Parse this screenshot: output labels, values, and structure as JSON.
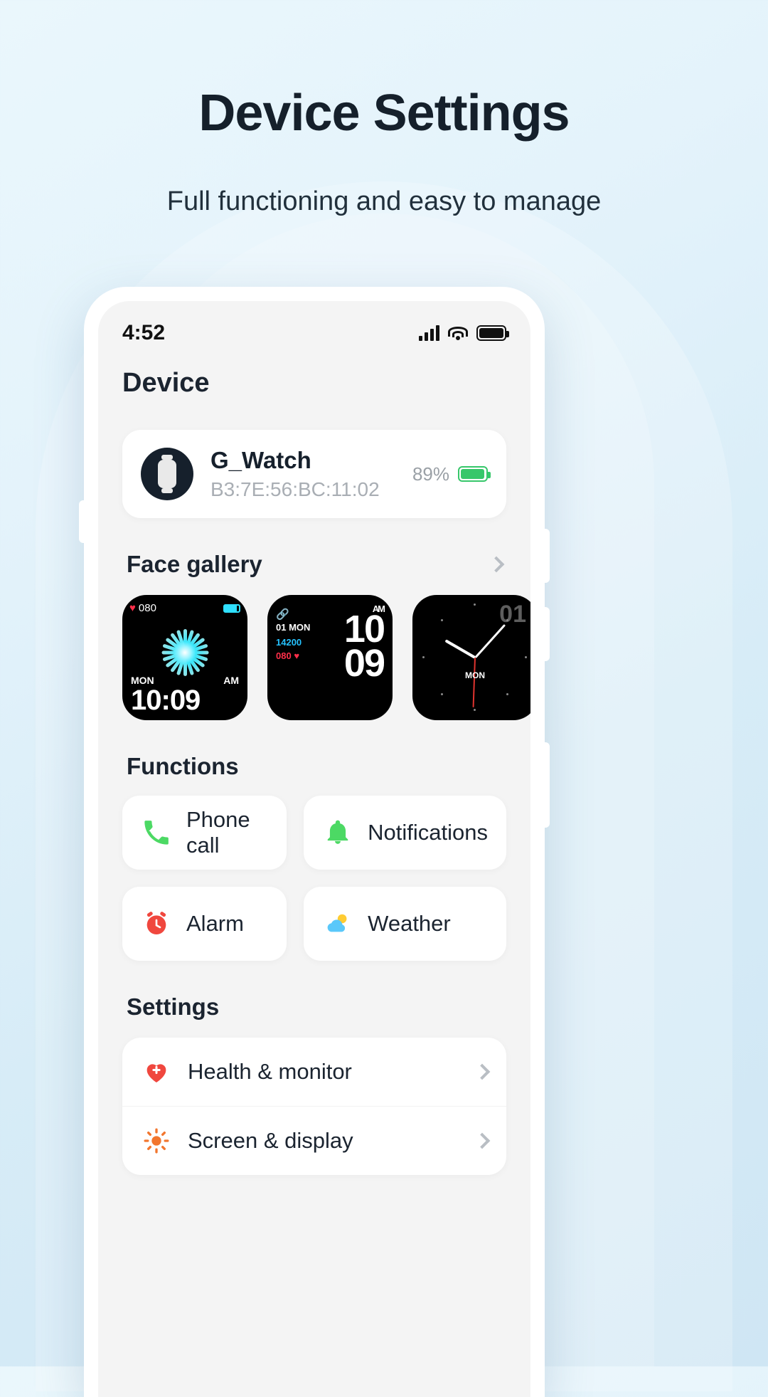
{
  "hero": {
    "title": "Device Settings",
    "subtitle": "Full functioning and easy to manage"
  },
  "statusbar": {
    "time": "4:52",
    "signal_icon": "signal-bars-icon",
    "wifi_icon": "wifi-icon",
    "battery_icon": "battery-full-icon"
  },
  "screen": {
    "page_title": "Device",
    "device": {
      "avatar_icon": "watch-icon",
      "name": "G_Watch",
      "mac": "B3:7E:56:BC:11:02",
      "battery_percent": "89%",
      "battery_icon": "battery-green-icon",
      "battery_color": "#37c76a"
    },
    "face_gallery": {
      "title": "Face gallery",
      "chevron_icon": "chevron-right-icon",
      "faces": [
        {
          "name": "flower-face",
          "heart_value": "080",
          "day": "MON",
          "meridiem": "AM",
          "time": "10:09"
        },
        {
          "name": "digital-face",
          "link_icon": "link-icon",
          "meridiem": "AM",
          "date": "01 MON",
          "steps": "14200",
          "heart": "080",
          "hour": "10",
          "minute": "09"
        },
        {
          "name": "analog-face",
          "date_number": "01",
          "day": "MON"
        }
      ]
    },
    "functions": {
      "title": "Functions",
      "items": [
        {
          "label": "Phone call",
          "icon": "phone-icon",
          "color": "#4cd964"
        },
        {
          "label": "Notifications",
          "icon": "bell-icon",
          "color": "#4cd964"
        },
        {
          "label": "Alarm",
          "icon": "alarm-clock-icon",
          "color": "#f0473e"
        },
        {
          "label": "Weather",
          "icon": "cloud-sun-icon",
          "color": "#5ac8fa"
        }
      ]
    },
    "settings": {
      "title": "Settings",
      "items": [
        {
          "label": "Health & monitor",
          "icon": "heart-plus-icon",
          "color": "#f0473e",
          "chevron": "chevron-right-icon"
        },
        {
          "label": "Screen & display",
          "icon": "brightness-icon",
          "color": "#f2762e",
          "chevron": "chevron-right-icon"
        }
      ]
    }
  }
}
